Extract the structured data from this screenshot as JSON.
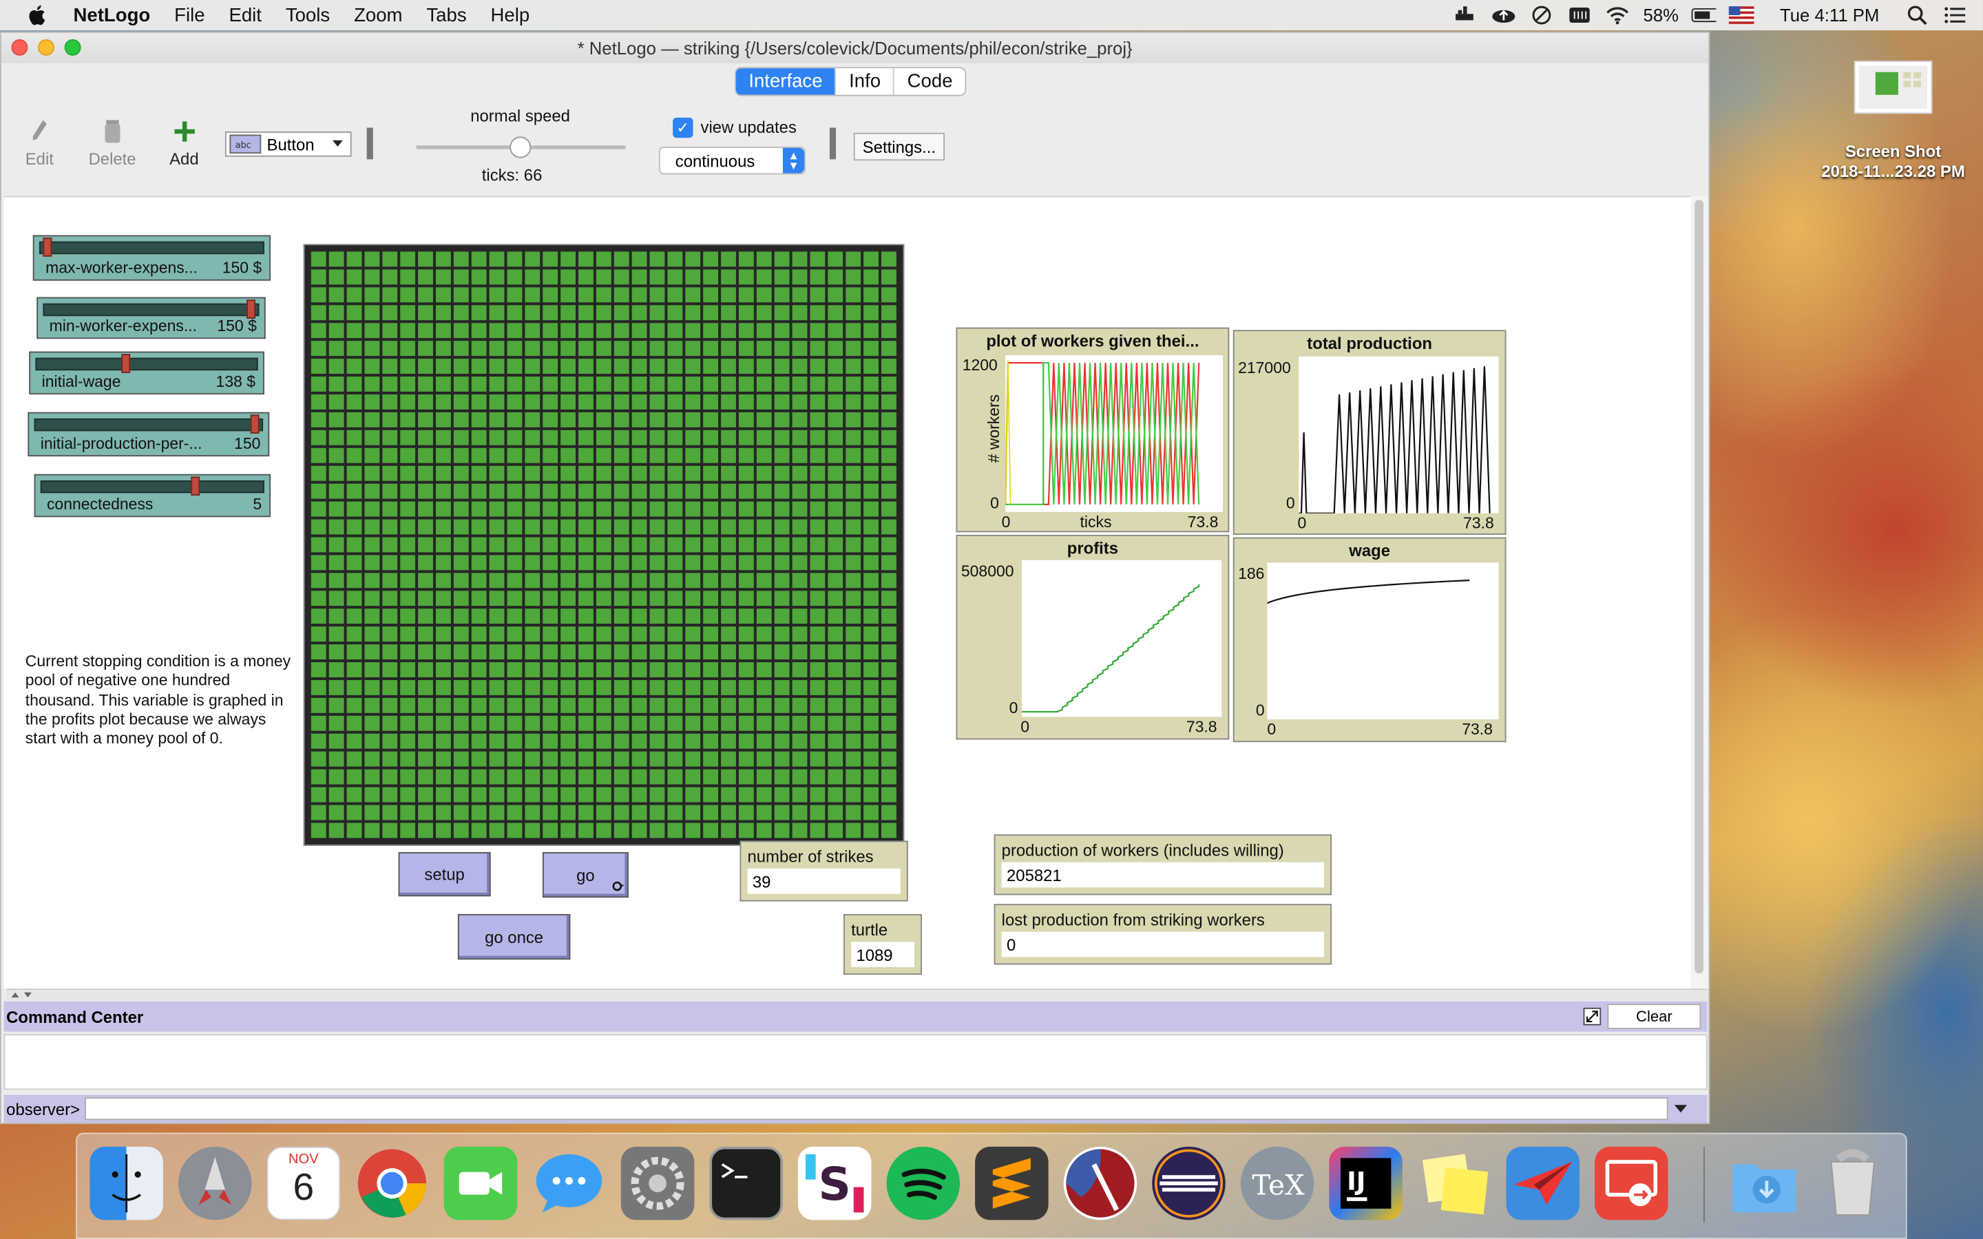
{
  "menubar": {
    "app_name": "NetLogo",
    "items": [
      "File",
      "Edit",
      "Tools",
      "Zoom",
      "Tabs",
      "Help"
    ],
    "battery": "58%",
    "clock": "Tue 4:11 PM"
  },
  "window": {
    "title": "* NetLogo — striking {/Users/colevick/Documents/phil/econ/strike_proj}",
    "tabs": [
      "Interface",
      "Info",
      "Code"
    ],
    "active_tab": "Interface"
  },
  "toolbar": {
    "edit_label": "Edit",
    "delete_label": "Delete",
    "add_label": "Add",
    "widget_type": "Button",
    "speed_label": "normal speed",
    "ticks_label": "ticks: 66",
    "view_updates_label": "view updates",
    "view_updates_checked": true,
    "update_mode": "continuous",
    "settings_label": "Settings..."
  },
  "sliders": [
    {
      "label": "max-worker-expens...",
      "value": "150 $",
      "level": 0.02
    },
    {
      "label": "min-worker-expens...",
      "value": "150 $",
      "level": 0.98
    },
    {
      "label": "initial-wage",
      "value": "138 $",
      "level": 0.4
    },
    {
      "label": "initial-production-per-...",
      "value": "150",
      "level": 0.98
    },
    {
      "label": "connectedness",
      "value": "5",
      "level": 0.7
    }
  ],
  "note_text": "Current stopping condition is a money pool of negative one hundred thousand. This variable is graphed in the profits plot because we always start with a money pool of 0.",
  "world": {
    "rows": 33,
    "cols": 33,
    "patch_color": "#4fa83a",
    "grid_color": "#262626"
  },
  "plots": {
    "workers": {
      "title": "plot of workers given thei...",
      "ylabel": "# workers",
      "xlabel": "ticks",
      "ymax": "1200",
      "ymin": "0",
      "xmin": "0",
      "xmax": "73.8"
    },
    "production": {
      "title": "total production",
      "ymax": "217000",
      "ymin": "0",
      "xmin": "0",
      "xmax": "73.8"
    },
    "profits": {
      "title": "profits",
      "ymax": "508000",
      "ymin": "0",
      "xmin": "0",
      "xmax": "73.8"
    },
    "wage": {
      "title": "wage",
      "ymax": "186",
      "ymin": "0",
      "xmin": "0",
      "xmax": "73.8"
    }
  },
  "buttons": {
    "setup": "setup",
    "go": "go",
    "go_once": "go once"
  },
  "monitors": {
    "strikes": {
      "label": "number of strikes",
      "value": "39"
    },
    "turtle": {
      "label": "turtle",
      "value": "1089"
    },
    "production": {
      "label": "production of workers (includes willing)",
      "value": "205821"
    },
    "lost": {
      "label": "lost production from striking workers",
      "value": "0"
    }
  },
  "command_center": {
    "title": "Command Center",
    "clear_label": "Clear",
    "prompt": "observer>"
  },
  "desktop": {
    "file_label_1": "Screen Shot",
    "file_label_2": "2018-11...23.28 PM"
  },
  "dock": {
    "calendar_month": "NOV",
    "calendar_day": "6",
    "items": [
      "finder",
      "launchpad",
      "calendar",
      "chrome",
      "facetime",
      "messages",
      "system-preferences",
      "terminal",
      "slack",
      "spotify",
      "sublime-text",
      "racket",
      "eclipse",
      "tex",
      "intellij",
      "stickies",
      "paper-plane",
      "remote-desktop",
      "downloads",
      "trash"
    ]
  }
}
